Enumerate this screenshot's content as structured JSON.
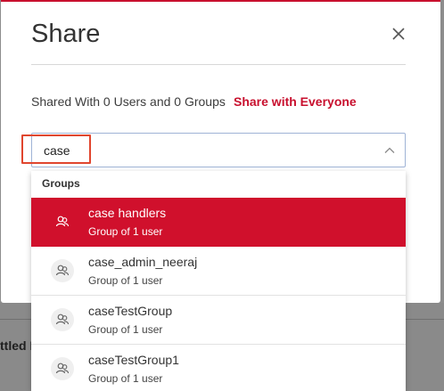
{
  "background": {
    "partial_text": "ttled F"
  },
  "modal": {
    "title": "Share",
    "shared_info": "Shared With 0 Users and 0 Groups",
    "share_everyone_label": "Share with Everyone"
  },
  "search": {
    "value": "case"
  },
  "dropdown": {
    "group_header": "Groups",
    "options": [
      {
        "name": "case handlers",
        "subtitle": "Group of 1 user",
        "active": true
      },
      {
        "name": "case_admin_neeraj",
        "subtitle": "Group of 1 user",
        "active": false
      },
      {
        "name": "caseTestGroup",
        "subtitle": "Group of 1 user",
        "active": false
      },
      {
        "name": "caseTestGroup1",
        "subtitle": "Group of 1 user",
        "active": false
      }
    ]
  },
  "colors": {
    "accent": "#c8102e",
    "highlight_annotation": "#e0462e"
  },
  "icons": {
    "close": "close-icon",
    "chevron": "chevron-up-icon",
    "group": "group-icon"
  }
}
